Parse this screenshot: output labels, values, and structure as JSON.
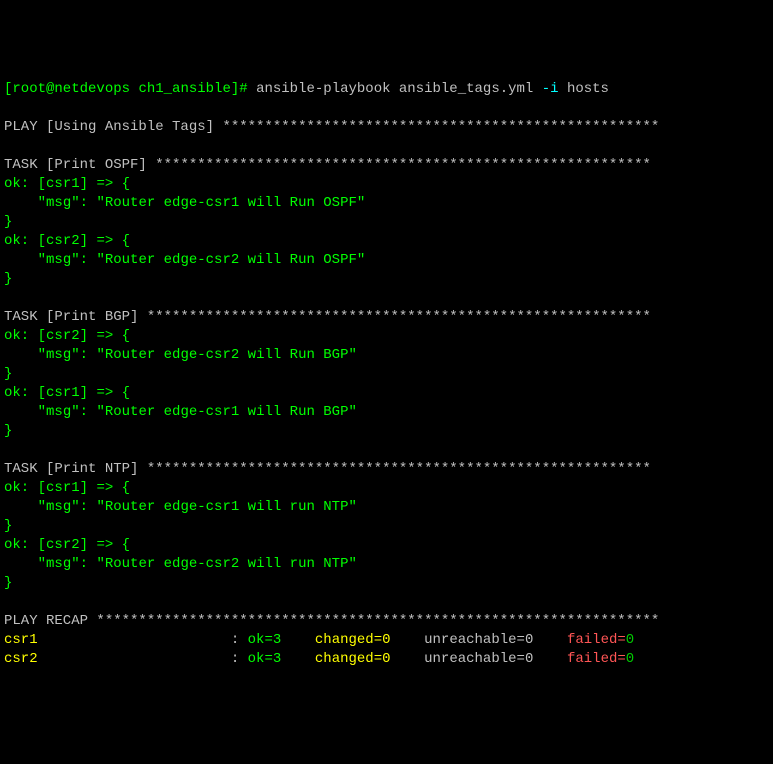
{
  "prompt": {
    "user_host": "[root@netdevops",
    "cwd": "ch1_ansible",
    "close": "]#",
    "command": "ansible-playbook ansible_tags.yml",
    "flag": "-i",
    "arg": "hosts"
  },
  "play": {
    "label": "PLAY [Using Ansible Tags]",
    "stars": "****************************************************"
  },
  "tasks": [
    {
      "header": "TASK [Print OSPF]",
      "stars": "***********************************************************",
      "results": [
        {
          "host": "csr1",
          "msg": "Router edge-csr1 will Run OSPF"
        },
        {
          "host": "csr2",
          "msg": "Router edge-csr2 will Run OSPF"
        }
      ]
    },
    {
      "header": "TASK [Print BGP]",
      "stars": "************************************************************",
      "results": [
        {
          "host": "csr2",
          "msg": "Router edge-csr2 will Run BGP"
        },
        {
          "host": "csr1",
          "msg": "Router edge-csr1 will Run BGP"
        }
      ]
    },
    {
      "header": "TASK [Print NTP]",
      "stars": "************************************************************",
      "results": [
        {
          "host": "csr1",
          "msg": "Router edge-csr1 will run NTP"
        },
        {
          "host": "csr2",
          "msg": "Router edge-csr2 will run NTP"
        }
      ]
    }
  ],
  "recap": {
    "label": "PLAY RECAP",
    "stars": "*******************************************************************",
    "rows": [
      {
        "host": "csr1",
        "ok": "3",
        "changed": "0",
        "unreachable": "0",
        "failed": "0"
      },
      {
        "host": "csr2",
        "ok": "3",
        "changed": "0",
        "unreachable": "0",
        "failed": "0"
      }
    ]
  },
  "labels": {
    "ok_prefix": "ok:",
    "arrow": "=>",
    "open_brace": "{",
    "close_brace": "}",
    "msg_key": "\"msg\":",
    "ok": "ok=",
    "changed": "changed=",
    "unreachable": "unreachable=",
    "failed": "failed="
  }
}
